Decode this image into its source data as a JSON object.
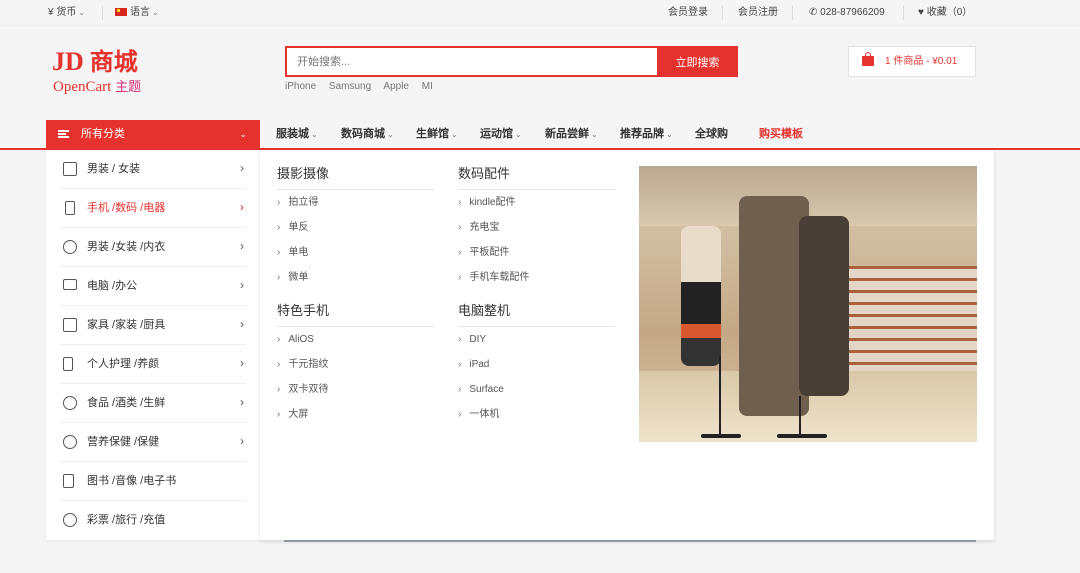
{
  "topbar": {
    "currency": "¥ 货币",
    "language": "语言",
    "login": "会员登录",
    "register": "会员注册",
    "phone": "028-87966209",
    "favorites": "收藏（0）"
  },
  "logo": {
    "main_latin": "JD",
    "main_cn": "商城",
    "sub_latin": "OpenCart",
    "sub_cn": "主题"
  },
  "search": {
    "placeholder": "开始搜索...",
    "button": "立即搜索",
    "hot_words": [
      "iPhone",
      "Samsung",
      "Apple",
      "MI"
    ]
  },
  "cart": {
    "summary": "1 件商品 - ¥0.01"
  },
  "nav": {
    "all_categories": "所有分类",
    "items": [
      {
        "label": "服装城"
      },
      {
        "label": "数码商城"
      },
      {
        "label": "生鲜馆"
      },
      {
        "label": "运动馆"
      },
      {
        "label": "新品尝鲜"
      },
      {
        "label": "推荐品牌"
      },
      {
        "label": "全球购"
      },
      {
        "label": "购买模板"
      }
    ]
  },
  "sidebar": {
    "categories": [
      {
        "label": "男装 / 女装",
        "icon": "shirt-icon"
      },
      {
        "label": "手机 /数码 /电器",
        "icon": "phone-icon"
      },
      {
        "label": "男装 /女装 /内衣",
        "icon": "glasses-icon"
      },
      {
        "label": "电脑 /办公",
        "icon": "monitor-icon"
      },
      {
        "label": "家具 /家装 /厨具",
        "icon": "sofa-icon"
      },
      {
        "label": "个人护理 /养颜",
        "icon": "bottle-icon"
      },
      {
        "label": "食品 /酒类 /生鲜",
        "icon": "bowl-icon"
      },
      {
        "label": "营养保健 /保健",
        "icon": "pills-icon"
      },
      {
        "label": "图书 /音像 /电子书",
        "icon": "book-icon"
      },
      {
        "label": "彩票 /旅行 /充值",
        "icon": "umbrella-icon"
      }
    ]
  },
  "mega": {
    "columns": [
      {
        "title": "摄影摄像",
        "items": [
          "拍立得",
          "单反",
          "单电",
          "微单"
        ]
      },
      {
        "title": "数码配件",
        "items": [
          "kindle配件",
          "充电宝",
          "平板配件",
          "手机车载配件"
        ]
      },
      {
        "title": "特色手机",
        "items": [
          "AliOS",
          "千元指纹",
          "双卡双待",
          "大屏"
        ]
      },
      {
        "title": "电脑整机",
        "items": [
          "DIY",
          "iPad",
          "Surface",
          "一体机"
        ]
      }
    ],
    "colors": {
      "accent": "#e6322e",
      "text": "#333333",
      "muted": "#777777"
    }
  }
}
